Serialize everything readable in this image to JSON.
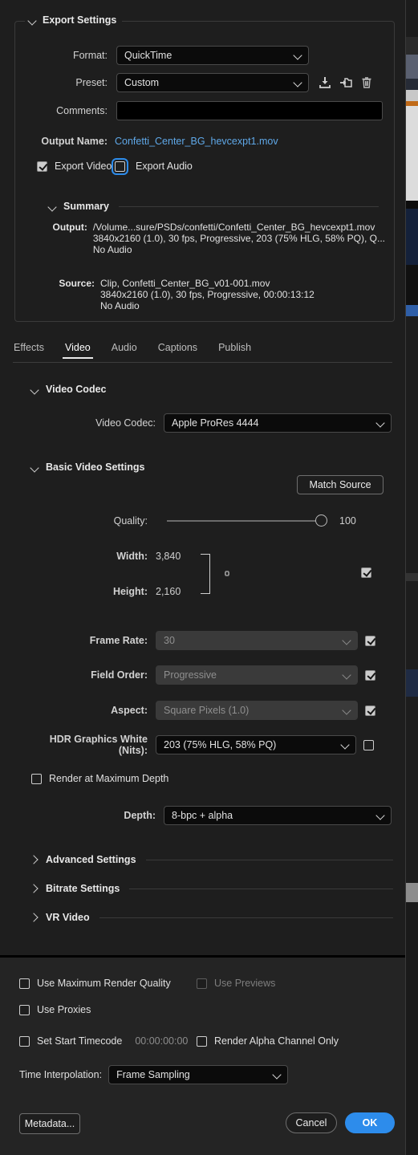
{
  "dialog": {
    "export_settings": {
      "title": "Export Settings",
      "format_label": "Format:",
      "format_value": "QuickTime",
      "preset_label": "Preset:",
      "preset_value": "Custom",
      "preset_actions": [
        {
          "name": "save-preset-icon",
          "tip": "Save Preset"
        },
        {
          "name": "import-preset-icon",
          "tip": "Import Preset"
        },
        {
          "name": "delete-preset-icon",
          "tip": "Delete Preset"
        }
      ],
      "comments_label": "Comments:",
      "comments_value": "",
      "comments_placeholder": "",
      "output_name_label": "Output Name:",
      "output_name_value": "Confetti_Center_BG_hevcexpt1.mov",
      "output_name_color": "#5fa8e8",
      "export_video_label": "Export Video",
      "export_video_checked": true,
      "export_audio_label": "Export Audio",
      "export_audio_checked": false
    },
    "summary": {
      "title": "Summary",
      "output_label": "Output:",
      "output_lines": [
        "/Volume...sure/PSDs/confetti/Confetti_Center_BG_hevcexpt1.mov",
        "3840x2160 (1.0), 30 fps, Progressive, 203 (75% HLG, 58% PQ), Q...",
        "No Audio"
      ],
      "source_label": "Source:",
      "source_lines": [
        "Clip, Confetti_Center_BG_v01-001.mov",
        "3840x2160 (1.0), 30 fps, Progressive, 00:00:13:12",
        "No Audio"
      ]
    },
    "tabs": [
      {
        "label": "Effects",
        "active": false
      },
      {
        "label": "Video",
        "active": true
      },
      {
        "label": "Audio",
        "active": false
      },
      {
        "label": "Captions",
        "active": false
      },
      {
        "label": "Publish",
        "active": false
      }
    ],
    "video_codec_section": {
      "title": "Video Codec",
      "codec_label": "Video Codec:",
      "codec_value": "Apple ProRes 4444"
    },
    "basic_video_settings": {
      "title": "Basic Video Settings",
      "match_source_label": "Match Source",
      "quality_label": "Quality:",
      "quality_value": "100",
      "quality_percent": 100,
      "width_label": "Width:",
      "width_value": "3,840",
      "height_label": "Height:",
      "height_value": "2,160",
      "link_icon_name": "link-icon",
      "dimensions_match_checked": true,
      "frame_rate_label": "Frame Rate:",
      "frame_rate_value": "30",
      "frame_rate_disabled": true,
      "frame_rate_checked": true,
      "field_order_label": "Field Order:",
      "field_order_value": "Progressive",
      "field_order_disabled": true,
      "field_order_checked": true,
      "aspect_label": "Aspect:",
      "aspect_value": "Square Pixels (1.0)",
      "aspect_disabled": true,
      "aspect_checked": true,
      "hdr_label": "HDR Graphics White (Nits):",
      "hdr_value": "203 (75% HLG, 58% PQ)",
      "hdr_checked": false,
      "render_max_depth_label": "Render at Maximum Depth",
      "render_max_depth_checked": false,
      "depth_label": "Depth:",
      "depth_value": "8-bpc + alpha"
    },
    "collapsed_sections": [
      {
        "title": "Advanced Settings"
      },
      {
        "title": "Bitrate Settings"
      },
      {
        "title": "VR Video"
      }
    ],
    "footer": {
      "use_max_render_quality_label": "Use Maximum Render Quality",
      "use_max_render_quality_checked": false,
      "use_previews_label": "Use Previews",
      "use_previews_checked": false,
      "use_previews_disabled": true,
      "use_proxies_label": "Use Proxies",
      "use_proxies_checked": false,
      "set_start_timecode_label": "Set Start Timecode",
      "set_start_timecode_checked": false,
      "start_timecode_value": "00:00:00:00",
      "render_alpha_label": "Render Alpha Channel Only",
      "render_alpha_checked": false,
      "time_interpolation_label": "Time Interpolation:",
      "time_interpolation_value": "Frame Sampling",
      "metadata_label": "Metadata...",
      "cancel_label": "Cancel",
      "ok_label": "OK",
      "ok_color": "#2d8ceb"
    }
  }
}
